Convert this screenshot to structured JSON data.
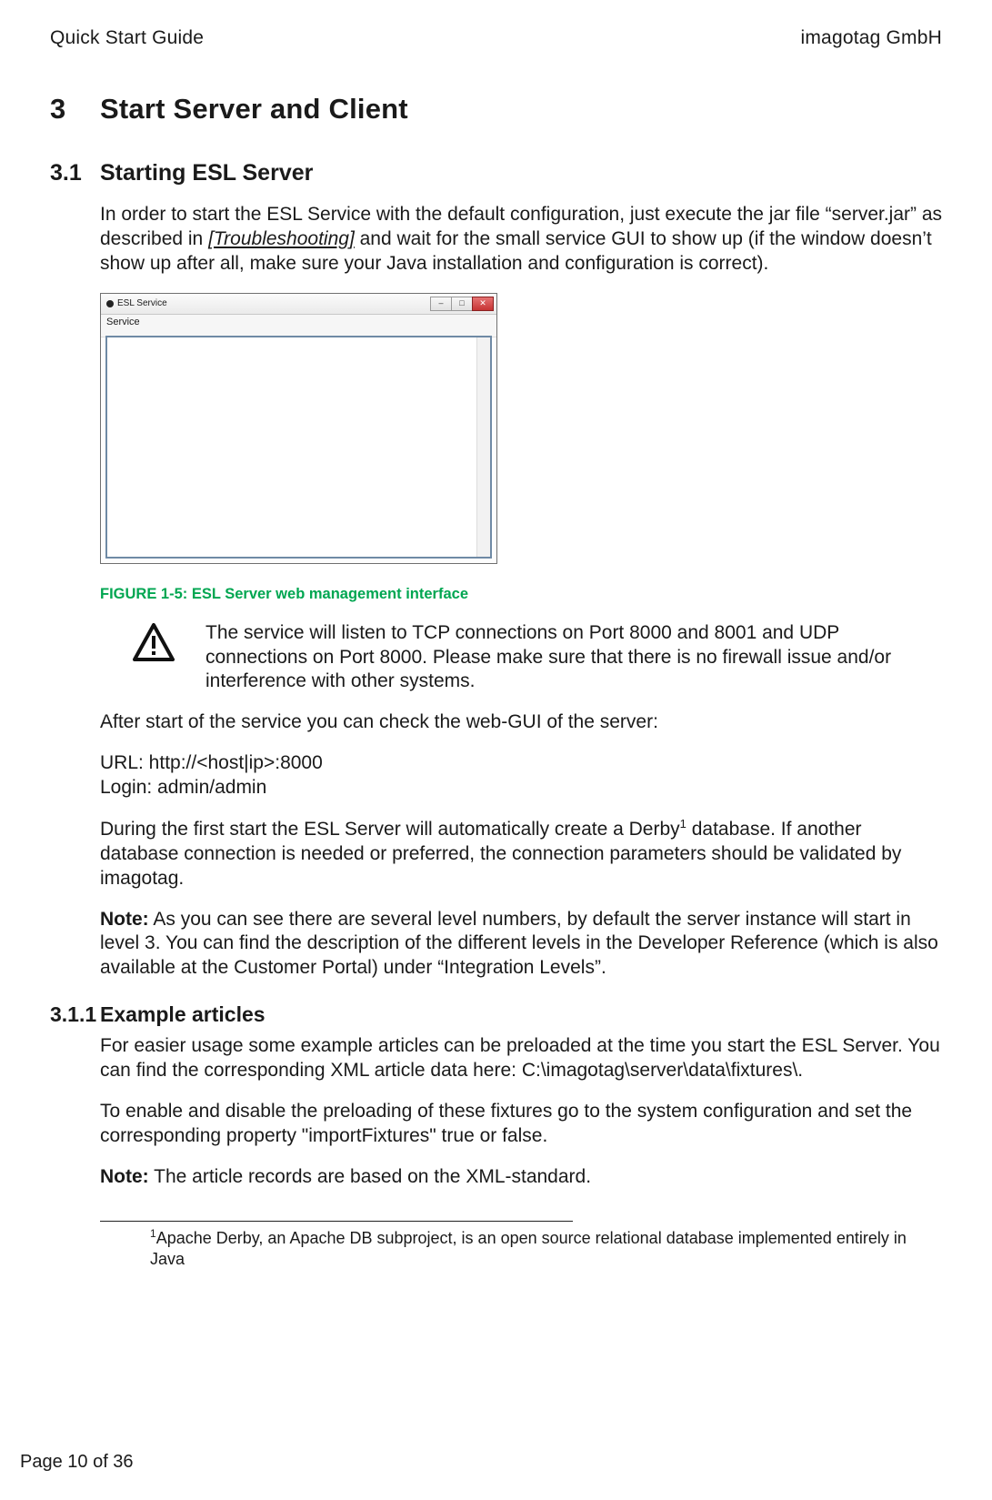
{
  "header": {
    "left": "Quick Start Guide",
    "right": "imagotag GmbH"
  },
  "chapter": {
    "number": "3",
    "title": "Start Server and Client"
  },
  "s31": {
    "number": "3.1",
    "title": "Starting ESL Server",
    "intro_a": "In order to start the ESL Service with the default configuration, just execute the jar file “server.jar” as described in ",
    "intro_link": "[Troubleshooting]",
    "intro_b": " and wait for the small service GUI to show up (if the window doesn’t show up after all, make sure your Java installation and configuration is correct)."
  },
  "figwin": {
    "title": "ESL Service",
    "menu": "Service",
    "min": "–",
    "max": "□",
    "close": "✕"
  },
  "figcap": "FIGURE 1-5: ESL Server web management interface",
  "warn": "The service will listen to TCP connections on Port 8000 and 8001 and UDP connections on Port 8000. Please make sure that there is no firewall issue and/or interference with other systems.",
  "after": "After start of the service you can check the web-GUI of the server:",
  "url_line": "URL: http://<host|ip>:8000",
  "login_line": "Login: admin/admin",
  "derby_a": "During the first start the ESL Server will automatically create a Derby",
  "derby_sup": "1",
  "derby_b": " database. If another database connection is needed or preferred, the connection parameters should be validated by imagotag.",
  "note1_label": "Note:",
  "note1_body": " As you can see there are several level numbers, by default the server instance will start in level 3. You can find the description of the different levels in the Developer Reference (which is also available at the Customer Portal) under “Integration Levels”.",
  "s311": {
    "number": "3.1.1",
    "title": "Example articles",
    "p1": "For easier usage some example articles can be preloaded at the time you start the ESL Server. You can find the corresponding XML article data here: C:\\imagotag\\server\\data\\fixtures\\.",
    "p2": "To enable and disable the preloading of these fixtures go to the system configuration and set the corresponding property \"importFixtures\" true or false.",
    "note_label": "Note:",
    "note_body": " The article records are based on the XML-standard."
  },
  "footnote": {
    "mark": "1",
    "text": "Apache Derby, an Apache DB subproject, is an open source relational database implemented entirely in Java"
  },
  "pager": "Page 10 of 36"
}
